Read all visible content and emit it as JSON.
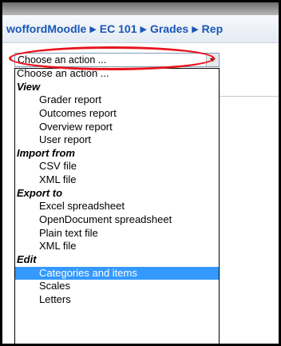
{
  "breadcrumb": {
    "items": [
      "woffordMoodle",
      "EC 101",
      "Grades",
      "Rep"
    ]
  },
  "action_select": {
    "value": "Choose an action ..."
  },
  "dropdown": {
    "first_option": "Choose an action ...",
    "groups": [
      {
        "label": "View",
        "items": [
          "Grader report",
          "Outcomes report",
          "Overview report",
          "User report"
        ]
      },
      {
        "label": "Import from",
        "items": [
          "CSV file",
          "XML file"
        ]
      },
      {
        "label": "Export to",
        "items": [
          "Excel spreadsheet",
          "OpenDocument spreadsheet",
          "Plain text file",
          "XML file"
        ]
      },
      {
        "label": "Edit",
        "items": [
          "Categories and items",
          "Scales",
          "Letters"
        ]
      }
    ],
    "highlighted_option": "Categories and items"
  },
  "colors": {
    "link": "#1a56b8",
    "selection": "#3399ff",
    "annotation": "#e8141d"
  },
  "icons": {
    "separator": "triangle-right-icon",
    "dropdown": "chevron-down-icon"
  }
}
